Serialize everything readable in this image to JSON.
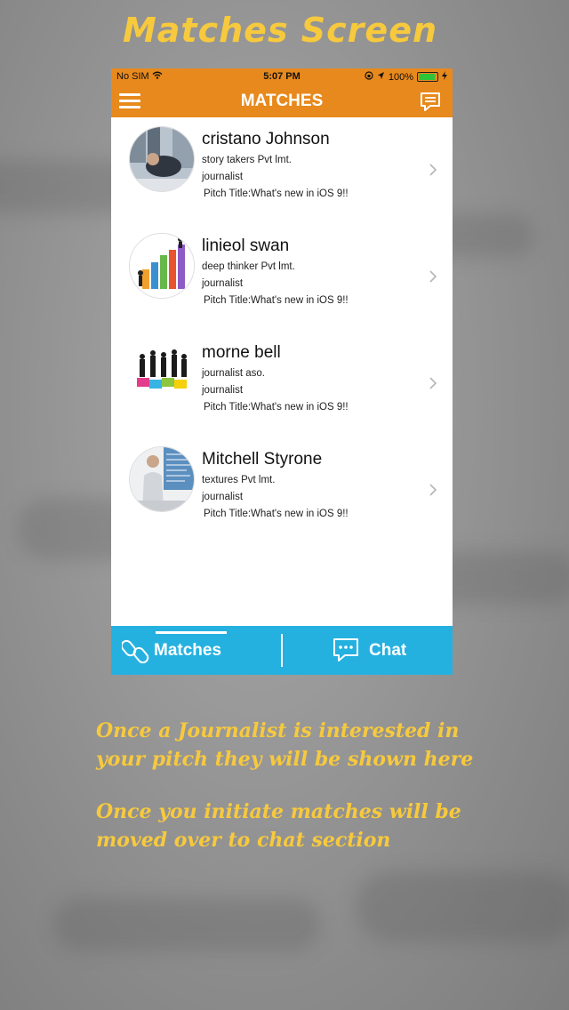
{
  "promo": {
    "title": "Matches Screen",
    "caption_1_line_1": "Once a Journalist is interested in",
    "caption_1_line_2": "your pitch they will be shown here",
    "caption_2_line_1": "Once you initiate matches will be",
    "caption_2_line_2": "moved over to chat section",
    "accent_color": "#f7c93d"
  },
  "status_bar": {
    "carrier": "No SIM",
    "time": "5:07 PM",
    "battery": "100%"
  },
  "nav": {
    "title": "MATCHES",
    "brand_color": "#e8891d",
    "left_icon": "menu-icon",
    "right_icon": "chat-bubble-icon"
  },
  "matches": [
    {
      "name": "cristano Johnson",
      "company": "story takers Pvt lmt.",
      "role": "journalist",
      "pitch": "Pitch Title:What's new in iOS 9!!"
    },
    {
      "name": "linieol swan",
      "company": "deep thinker Pvt lmt.",
      "role": "journalist",
      "pitch": "Pitch Title:What's new in iOS 9!!"
    },
    {
      "name": "morne bell",
      "company": "journalist aso.",
      "role": "journalist",
      "pitch": "Pitch Title:What's new in iOS 9!!"
    },
    {
      "name": "Mitchell Styrone",
      "company": "textures Pvt lmt.",
      "role": "journalist",
      "pitch": "Pitch Title:What's new in iOS 9!!"
    }
  ],
  "tabbar": {
    "color": "#25b1e0",
    "matches_label": "Matches",
    "chat_label": "Chat",
    "selected": "Matches"
  }
}
